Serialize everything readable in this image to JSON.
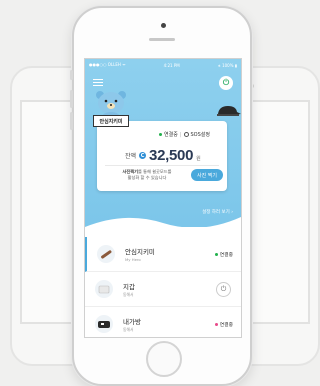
{
  "status_bar": {
    "carrier": "●●●○○ OLLEH ᯤ",
    "time": "4:21 PM",
    "battery": "∗ 100% ▮"
  },
  "card": {
    "name": "안심지키미",
    "connection": "연결중",
    "sos": "SOS설정",
    "balance_label": "잔액",
    "coin_symbol": "C",
    "balance": "32,500",
    "unit": "원",
    "desc_line1_bold": "사진찍기",
    "desc_line1_rest": "를 통해 쉴곳모드를",
    "desc_line2": "활성화 할 수 있습니다",
    "photo_button": "사진 찍기"
  },
  "more_link": "설정 하러 보기 ›",
  "devices": [
    {
      "title": "안심지키미",
      "sub": "My Hero",
      "status": "연결중",
      "status_color": "#22b14c"
    },
    {
      "title": "지갑",
      "sub": "동해서",
      "status": ""
    },
    {
      "title": "내가방",
      "sub": "동해서",
      "status": "연결중",
      "status_color": "#e84a8a"
    }
  ],
  "colors": {
    "sky": "#7cc6ea",
    "accent": "#4aa9dc",
    "green": "#22b14c"
  }
}
